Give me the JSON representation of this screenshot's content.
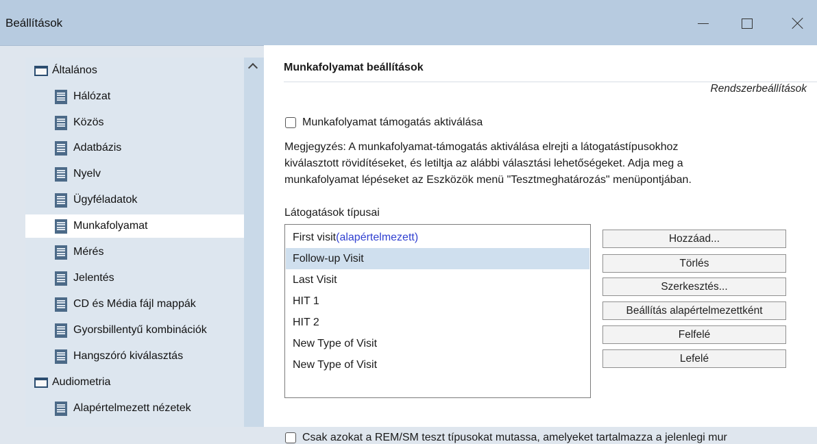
{
  "window": {
    "title": "Beállítások",
    "controls": {
      "minimize": "minimize-icon",
      "maximize": "maximize-icon",
      "close": "close-icon"
    }
  },
  "sidebar": {
    "items": [
      {
        "label": "Általános",
        "icon": "folder-icon",
        "level": 0,
        "selected": false
      },
      {
        "label": "Hálózat",
        "icon": "document-icon",
        "level": 1,
        "selected": false
      },
      {
        "label": "Közös",
        "icon": "document-icon",
        "level": 1,
        "selected": false
      },
      {
        "label": "Adatbázis",
        "icon": "document-icon",
        "level": 1,
        "selected": false
      },
      {
        "label": "Nyelv",
        "icon": "document-icon",
        "level": 1,
        "selected": false
      },
      {
        "label": "Ügyféladatok",
        "icon": "document-icon",
        "level": 1,
        "selected": false
      },
      {
        "label": "Munkafolyamat",
        "icon": "document-icon",
        "level": 1,
        "selected": true
      },
      {
        "label": "Mérés",
        "icon": "document-icon",
        "level": 1,
        "selected": false
      },
      {
        "label": "Jelentés",
        "icon": "document-icon",
        "level": 1,
        "selected": false
      },
      {
        "label": "CD és Média fájl mappák",
        "icon": "document-icon",
        "level": 1,
        "selected": false
      },
      {
        "label": "Gyorsbillentyű kombinációk",
        "icon": "document-icon",
        "level": 1,
        "selected": false
      },
      {
        "label": "Hangszóró kiválasztás",
        "icon": "document-icon",
        "level": 1,
        "selected": false
      },
      {
        "label": "Audiometria",
        "icon": "folder-icon",
        "level": 0,
        "selected": false
      },
      {
        "label": "Alapértelmezett nézetek",
        "icon": "document-icon",
        "level": 1,
        "selected": false
      }
    ]
  },
  "main": {
    "section_title": "Munkafolyamat beállítások",
    "system_link": "Rendszerbeállítások",
    "workflow_checkbox": {
      "label": "Munkafolyamat támogatás aktiválása",
      "checked": false
    },
    "note_lines": [
      "Megjegyzés: A munkafolyamat-támogatás aktiválása elrejti a látogatástípusokhoz",
      "kiválasztott rövidítéseket, és letiltja az alábbi választási lehetőségeket. Adja meg a",
      "munkafolyamat lépéseket az Eszközök menü \"Tesztmeghatározás\" menüpontjában."
    ],
    "visit_types_label": "Látogatások típusai",
    "visit_types": [
      {
        "name": "First visit",
        "suffix": "(alapértelmezett)",
        "selected": false
      },
      {
        "name": "Follow-up Visit",
        "suffix": "",
        "selected": true
      },
      {
        "name": "Last Visit",
        "suffix": "",
        "selected": false
      },
      {
        "name": "HIT 1",
        "suffix": "",
        "selected": false
      },
      {
        "name": "HIT 2",
        "suffix": "",
        "selected": false
      },
      {
        "name": "New Type of Visit",
        "suffix": "",
        "selected": false
      },
      {
        "name": "New Type of Visit",
        "suffix": "",
        "selected": false
      }
    ],
    "buttons": {
      "add": "Hozzáad...",
      "delete": "Törlés",
      "edit": "Szerkesztés...",
      "set_default": "Beállítás alapértelmezettként",
      "up": "Felfelé",
      "down": "Lefelé"
    },
    "bottom_checkbox": {
      "label": "Csak azokat a REM/SM teszt típusokat mutassa, amelyeket tartalmazza a jelenlegi mur",
      "checked": false
    }
  },
  "colors": {
    "titlebar": "#b7cbe0",
    "sidebar_bg": "#dde6ef",
    "selection": "#cfdfee",
    "default_tag": "#2f3fd0"
  }
}
